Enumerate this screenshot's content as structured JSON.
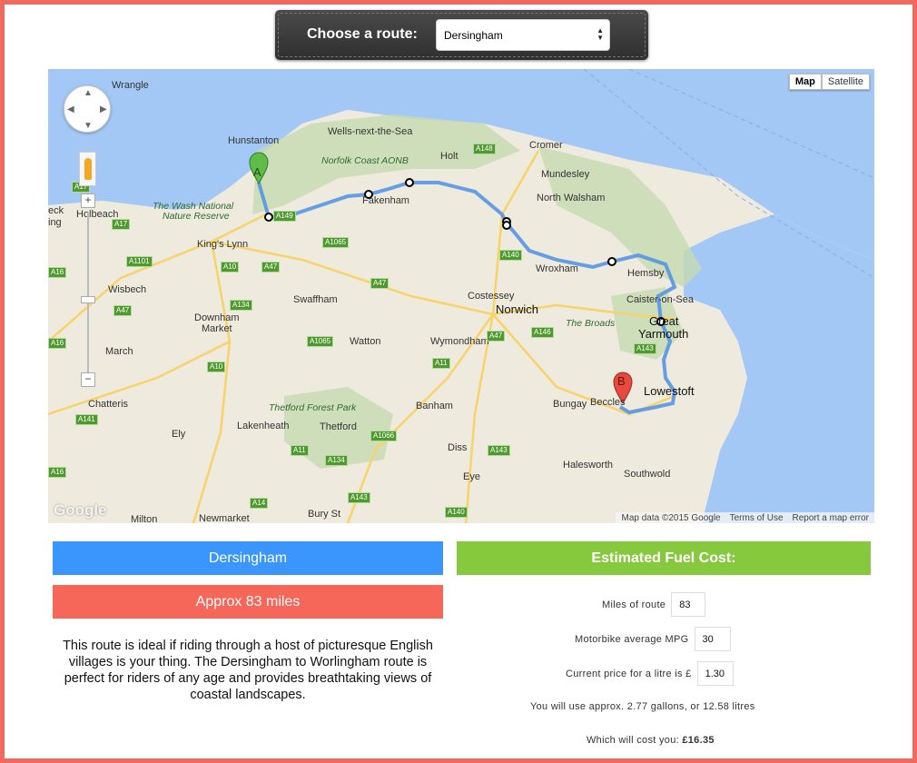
{
  "header": {
    "choose_label": "Choose a route:",
    "selected_route": "Dersingham"
  },
  "map": {
    "map_button": "Map",
    "satellite_button": "Satellite",
    "attribution": "Map data ©2015 Google",
    "terms": "Terms of Use",
    "report": "Report a map error",
    "logo": "Google",
    "zoom_in": "+",
    "zoom_out": "−",
    "marker_a": "A",
    "marker_b": "B",
    "places": [
      "Wrangle",
      "Hunstanton",
      "Wells-next-the-Sea",
      "Cromer",
      "Holt",
      "Mundesley",
      "North Walsham",
      "Norfolk Coast AONB",
      "The Wash National",
      "Nature Reserve",
      "Holbeach",
      "King's Lynn",
      "Fakenham",
      "Wisbech",
      "Downham",
      "Market",
      "Swaffham",
      "Costessey",
      "Norwich",
      "Wroxham",
      "Hemsby",
      "Caister-on-Sea",
      "Great",
      "Yarmouth",
      "The Broads",
      "March",
      "Watton",
      "Wymondham",
      "Thetford Forest Park",
      "Thetford",
      "Lakenheath",
      "Chatteris",
      "Ely",
      "Banham",
      "Diss",
      "Bungay",
      "Beccles",
      "Lowestoft",
      "Halesworth",
      "Southwold",
      "Eye",
      "Newmarket",
      "Bury St",
      "Milton",
      "eck",
      "ing"
    ],
    "roads": [
      "A17",
      "A17",
      "A148",
      "A149",
      "A1065",
      "A1101",
      "A10",
      "A47",
      "A47",
      "A140",
      "A47",
      "A134",
      "A1065",
      "A47",
      "A146",
      "A10",
      "A11",
      "A143",
      "A1066",
      "A11",
      "A143",
      "A134",
      "A141",
      "A143",
      "A14",
      "A140",
      "A16",
      "A16",
      "A16"
    ]
  },
  "summary": {
    "route_name": "Dersingham",
    "distance": "Approx 83 miles",
    "description": "This route is ideal if riding through a host of picturesque English villages is your thing. The Dersingham to Worlingham route is perfect for riders of any age and provides breathtaking views of coastal landscapes."
  },
  "fuel": {
    "title": "Estimated Fuel Cost:",
    "miles_label": "Miles of route",
    "miles_value": "83",
    "mpg_label": "Motorbike average MPG",
    "mpg_value": "30",
    "price_label": "Current price for a litre is £",
    "price_value": "1.30",
    "usage_text": "You will use approx. 2.77 gallons, or 12.58 litres",
    "cost_label": "Which will cost you:",
    "cost_value": "£16.35"
  },
  "colors": {
    "frame": "#f26a5e",
    "route_blue": "#3a96fc",
    "fuel_green": "#86c93f",
    "distance_red": "#f6675a",
    "sea": "#a4c8f5",
    "land": "#eeeadd"
  }
}
